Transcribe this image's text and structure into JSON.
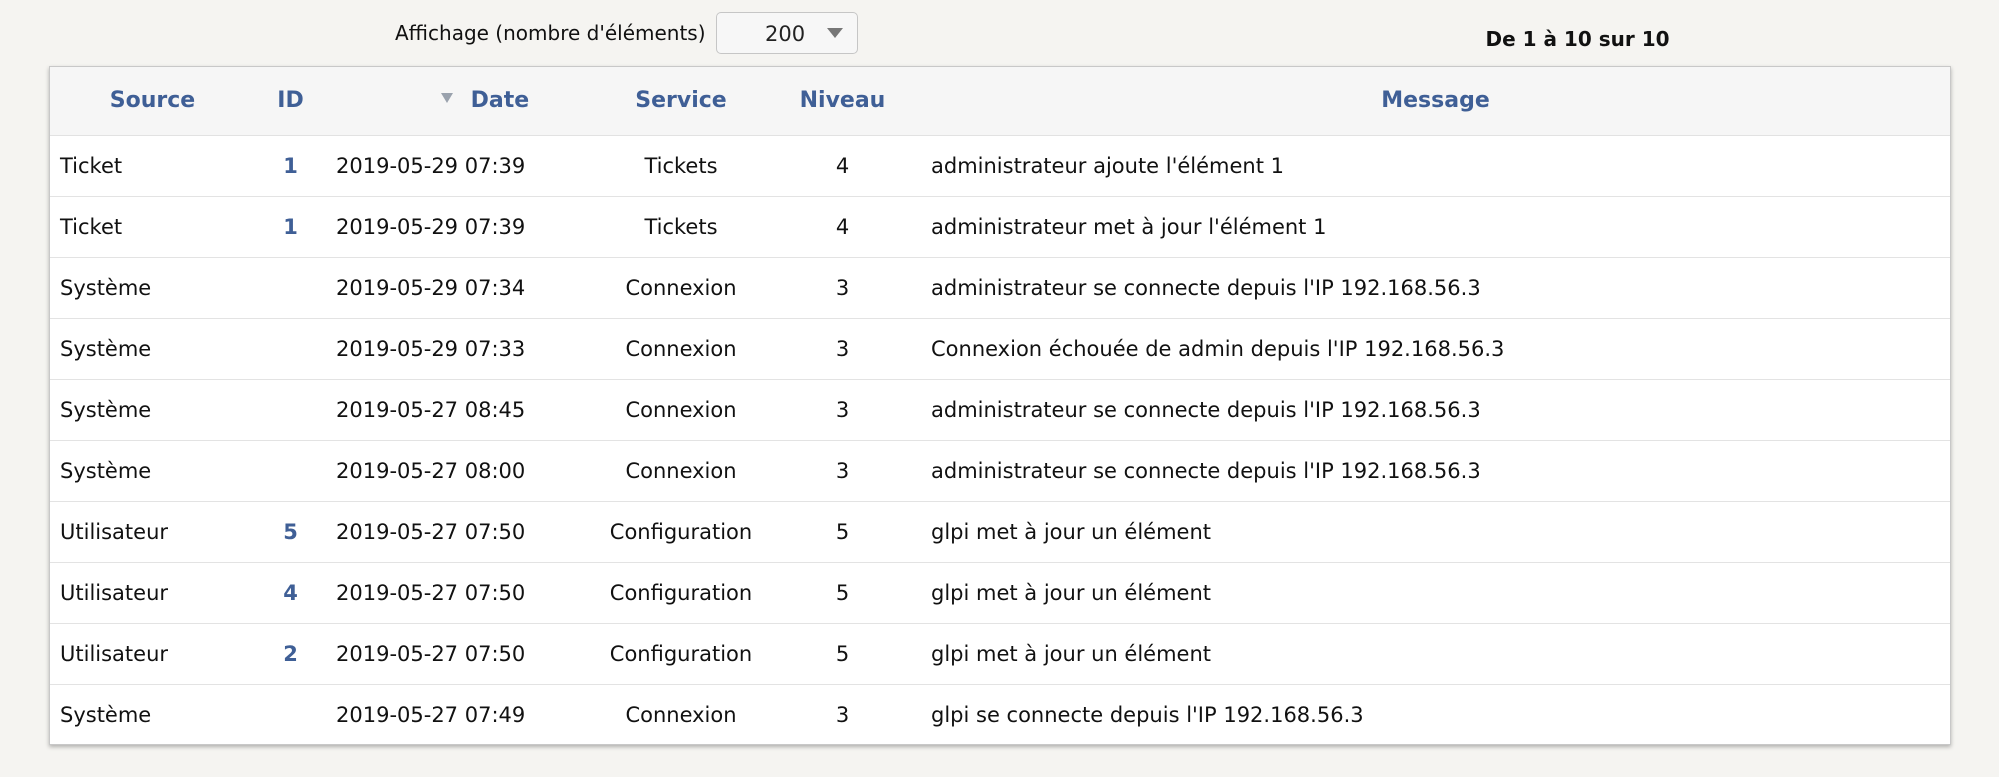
{
  "controls": {
    "display_label": "Affichage (nombre d'éléments)",
    "page_size": "200",
    "pager_text": "De 1 à 10 sur 10"
  },
  "table": {
    "headers": {
      "source": "Source",
      "id": "ID",
      "date": "Date",
      "service": "Service",
      "level": "Niveau",
      "message": "Message"
    },
    "rows": [
      {
        "source": "Ticket",
        "id": "1",
        "date": "2019-05-29 07:39",
        "service": "Tickets",
        "level": "4",
        "message": "administrateur ajoute l'élément 1"
      },
      {
        "source": "Ticket",
        "id": "1",
        "date": "2019-05-29 07:39",
        "service": "Tickets",
        "level": "4",
        "message": "administrateur met à jour l'élément 1"
      },
      {
        "source": "Système",
        "id": "",
        "date": "2019-05-29 07:34",
        "service": "Connexion",
        "level": "3",
        "message": "administrateur se connecte depuis l'IP 192.168.56.3"
      },
      {
        "source": "Système",
        "id": "",
        "date": "2019-05-29 07:33",
        "service": "Connexion",
        "level": "3",
        "message": "Connexion échouée de admin depuis l'IP 192.168.56.3"
      },
      {
        "source": "Système",
        "id": "",
        "date": "2019-05-27 08:45",
        "service": "Connexion",
        "level": "3",
        "message": "administrateur se connecte depuis l'IP 192.168.56.3"
      },
      {
        "source": "Système",
        "id": "",
        "date": "2019-05-27 08:00",
        "service": "Connexion",
        "level": "3",
        "message": "administrateur se connecte depuis l'IP 192.168.56.3"
      },
      {
        "source": "Utilisateur",
        "id": "5",
        "date": "2019-05-27 07:50",
        "service": "Configuration",
        "level": "5",
        "message": "glpi met à jour un élément"
      },
      {
        "source": "Utilisateur",
        "id": "4",
        "date": "2019-05-27 07:50",
        "service": "Configuration",
        "level": "5",
        "message": "glpi met à jour un élément"
      },
      {
        "source": "Utilisateur",
        "id": "2",
        "date": "2019-05-27 07:50",
        "service": "Configuration",
        "level": "5",
        "message": "glpi met à jour un élément"
      },
      {
        "source": "Système",
        "id": "",
        "date": "2019-05-27 07:49",
        "service": "Connexion",
        "level": "3",
        "message": "glpi se connecte depuis l'IP 192.168.56.3"
      }
    ]
  },
  "colors": {
    "background": "#f5f4f1",
    "link_blue": "#3f5f96",
    "header_background": "#f6f6f6",
    "border": "#e3e3e3"
  },
  "icons": {
    "sort": "sort-descending-icon",
    "dropdown": "chevron-down-icon"
  }
}
